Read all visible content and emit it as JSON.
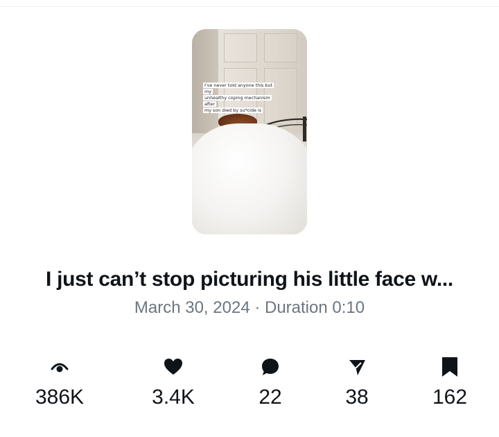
{
  "video": {
    "overlay_lines": [
      "I've never told anyone this but my",
      "unhealthy coping mechanism after",
      "my son died by su*cide is"
    ],
    "title": "I just can’t stop picturing his little face w...",
    "meta": "March 30, 2024 · Duration 0:10"
  },
  "stats": {
    "views": {
      "icon": "eye-icon",
      "value": "386K"
    },
    "likes": {
      "icon": "heart-icon",
      "value": "3.4K"
    },
    "replies": {
      "icon": "comment-icon",
      "value": "22"
    },
    "shares": {
      "icon": "send-icon",
      "value": "38"
    },
    "bookmarks": {
      "icon": "bookmark-icon",
      "value": "162"
    }
  },
  "colors": {
    "text_primary": "#0f1419",
    "text_secondary": "#6b7680"
  }
}
